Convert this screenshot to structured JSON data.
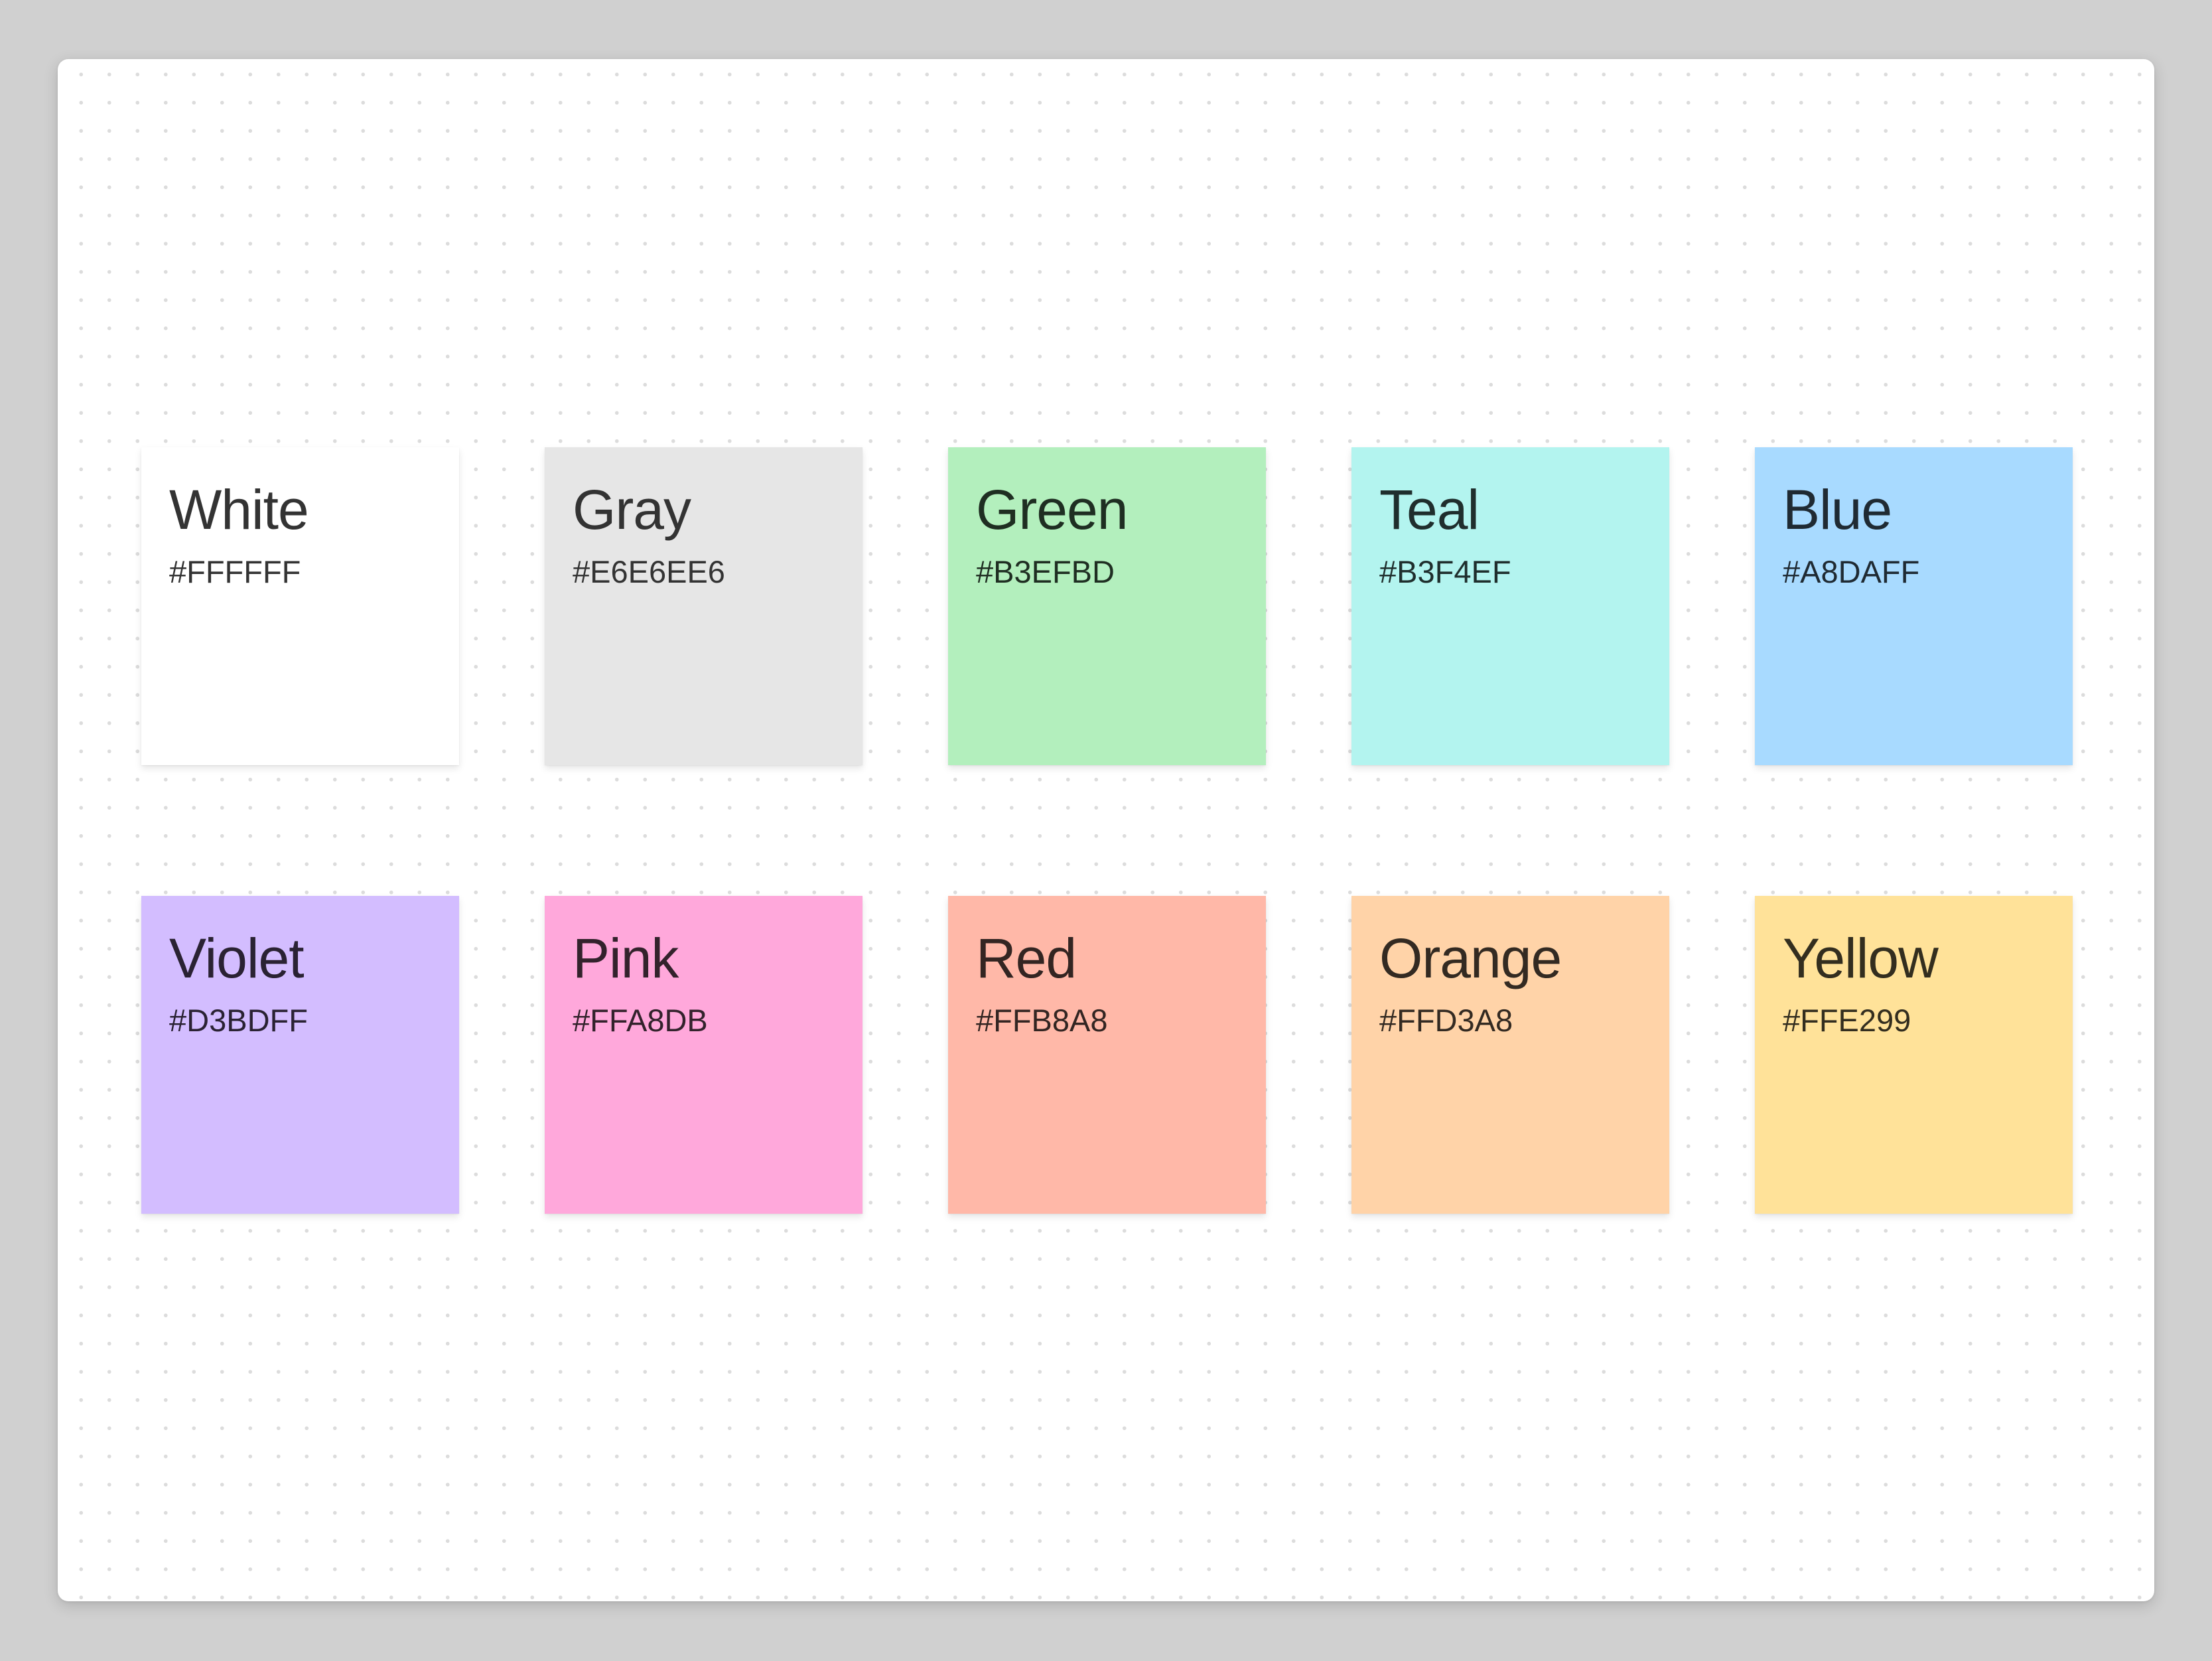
{
  "board": {
    "notes": [
      {
        "name": "White",
        "hex": "#FFFFFF",
        "bg": "#FFFFFF",
        "text_color": "#333333"
      },
      {
        "name": "Gray",
        "hex": "#E6E6EE6",
        "bg": "#E6E6E6",
        "text_color": "#333333"
      },
      {
        "name": "Green",
        "hex": "#B3EFBD",
        "bg": "#B3EFBD",
        "text_color": "#1F2E22"
      },
      {
        "name": "Teal",
        "hex": "#B3F4EF",
        "bg": "#B3F4EF",
        "text_color": "#1F2E2D"
      },
      {
        "name": "Blue",
        "hex": "#A8DAFF",
        "bg": "#A8DAFF",
        "text_color": "#1F2A33"
      },
      {
        "name": "Violet",
        "hex": "#D3BDFF",
        "bg": "#D3BDFF",
        "text_color": "#2A2233"
      },
      {
        "name": "Pink",
        "hex": "#FFA8DB",
        "bg": "#FFA8DB",
        "text_color": "#33222C"
      },
      {
        "name": "Red",
        "hex": "#FFB8A8",
        "bg": "#FFB8A8",
        "text_color": "#332522"
      },
      {
        "name": "Orange",
        "hex": "#FFD3A8",
        "bg": "#FFD3A8",
        "text_color": "#332A22"
      },
      {
        "name": "Yellow",
        "hex": "#FFE299",
        "bg": "#FFE299",
        "text_color": "#332E1F"
      }
    ]
  }
}
